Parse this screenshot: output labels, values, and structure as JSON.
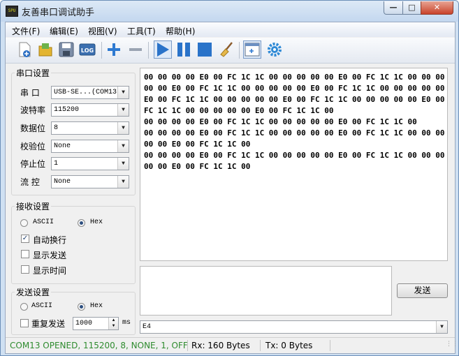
{
  "window": {
    "title": "友善串口调试助手",
    "app_icon_text": "SPU"
  },
  "menu": {
    "items": [
      "文件(F)",
      "编辑(E)",
      "视图(V)",
      "工具(T)",
      "帮助(H)"
    ]
  },
  "serial_settings": {
    "title": "串口设置",
    "port_label": "串 口",
    "port_value": "USB-SE...(COM13",
    "baud_label": "波特率",
    "baud_value": "115200",
    "databits_label": "数据位",
    "databits_value": "8",
    "parity_label": "校验位",
    "parity_value": "None",
    "stopbits_label": "停止位",
    "stopbits_value": "1",
    "flow_label": "流 控",
    "flow_value": "None"
  },
  "receive_settings": {
    "title": "接收设置",
    "ascii_label": "ASCII",
    "hex_label": "Hex",
    "selected": "Hex",
    "auto_newline_label": "自动换行",
    "auto_newline_checked": true,
    "show_send_label": "显示发送",
    "show_send_checked": false,
    "show_time_label": "显示时间",
    "show_time_checked": false
  },
  "send_settings": {
    "title": "发送设置",
    "ascii_label": "ASCII",
    "hex_label": "Hex",
    "selected": "Hex",
    "repeat_label": "重复发送",
    "repeat_checked": false,
    "interval_value": "1000",
    "interval_unit": "ms"
  },
  "receive_area": {
    "text": "00 00 00 00 E0 00 FC 1C 1C 00 00 00 00 00 E0 00 FC 1C 1C 00 00 00 00 00 E0 00 FC 1C 1C 00 00 00 00 00 E0 00 FC 1C 1C 00 00 00 00 00 E0 00 FC 1C 1C 00 00 00 00 00 E0 00 FC 1C 1C 00 00 00 00 00 E0 00 FC 1C 1C 00 00 00 00 00 E0 00 FC 1C 1C 00\n00 00 00 00 E0 00 FC 1C 1C 00 00 00 00 00 E0 00 FC 1C 1C 00\n00 00 00 00 E0 00 FC 1C 1C 00 00 00 00 00 E0 00 FC 1C 1C 00 00 00 00 00 E0 00 FC 1C 1C 00\n00 00 00 00 E0 00 FC 1C 1C 00 00 00 00 00 E0 00 FC 1C 1C 00 00 00 00 00 E0 00 FC 1C 1C 00"
  },
  "send_area": {
    "text": ""
  },
  "send_button": {
    "label": "发送"
  },
  "history": {
    "value": "E4"
  },
  "status": {
    "connection": "COM13 OPENED, 115200, 8, NONE, 1, OFF",
    "rx": "Rx: 160 Bytes",
    "tx": "Tx: 0 Bytes",
    "connection_color": "#2e8b2e"
  },
  "toolbar": {
    "icons": [
      "new-file-icon",
      "open-folder-icon",
      "save-icon",
      "log-icon",
      "add-icon",
      "remove-icon",
      "play-icon",
      "pause-icon",
      "stop-icon",
      "broom-icon",
      "new-window-icon",
      "settings-gear-icon"
    ],
    "log_text": "LOG"
  }
}
